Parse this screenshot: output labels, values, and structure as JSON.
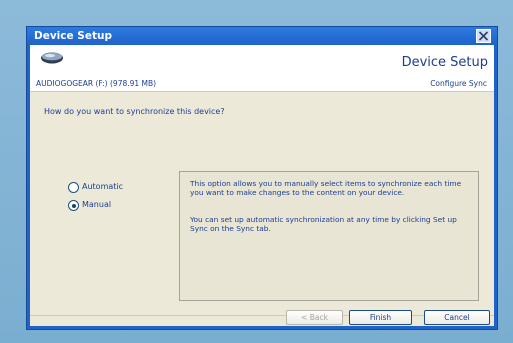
{
  "window": {
    "title": "Device Setup"
  },
  "header": {
    "title": "Device Setup",
    "device_name": "AUDIOGOGEAR (F:) (978.91 MB)",
    "step": "Configure Sync"
  },
  "question": "How do you want to synchronize this device?",
  "options": [
    {
      "label": "Automatic",
      "selected": false
    },
    {
      "label": "Manual",
      "selected": true
    }
  ],
  "description": {
    "p1": "This option allows you to manually select items to synchronize each time you want to make changes to the content on your device.",
    "p2": "You can set up automatic synchronization at any time by clicking Set up Sync on the Sync tab."
  },
  "buttons": {
    "back": "< Back",
    "finish": "Finish",
    "cancel": "Cancel"
  },
  "colors": {
    "titlebar": "#1f63c9",
    "desktop": "#79aed0",
    "dialog_body": "#ece9d8",
    "text": "#1b3f8f"
  },
  "icons": {
    "device": "portable-device-icon",
    "close": "close-icon"
  }
}
